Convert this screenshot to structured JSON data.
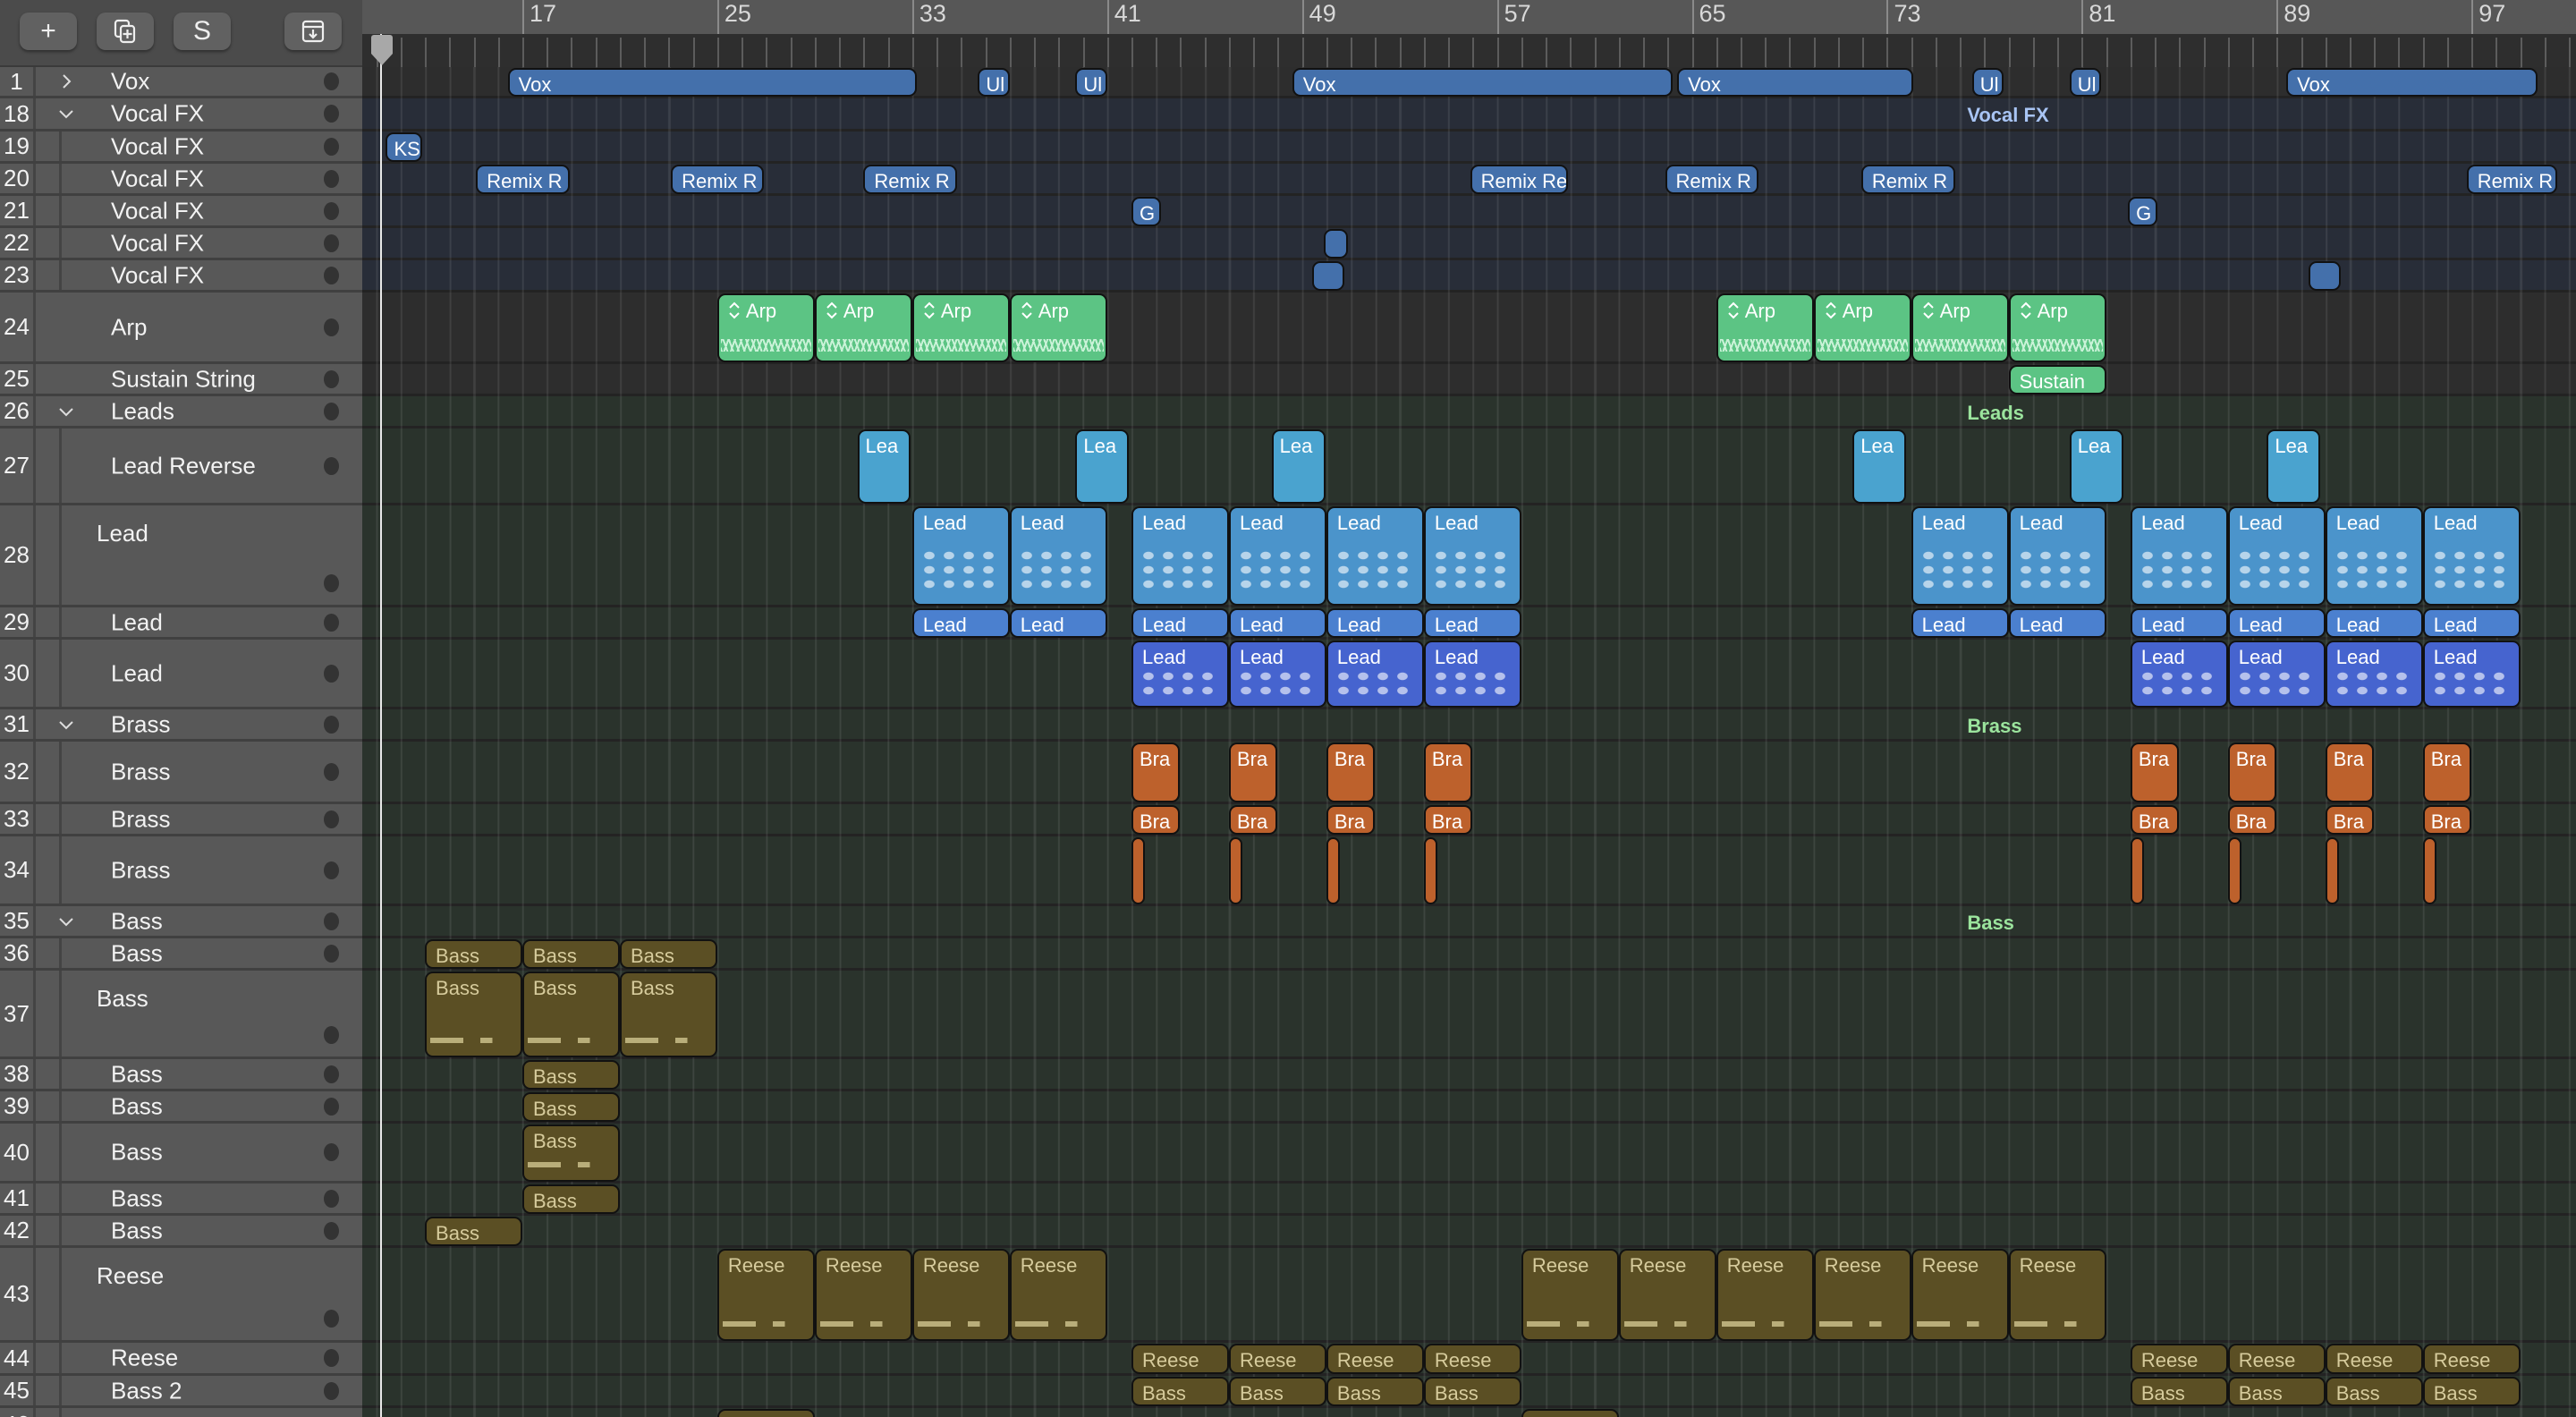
{
  "toolbar": {
    "add_label": "+",
    "solo_label": "S"
  },
  "ruler": {
    "labels": [
      "17",
      "25",
      "33",
      "41",
      "49",
      "57",
      "65",
      "73",
      "81",
      "89",
      "97"
    ],
    "label_bars": [
      17,
      25,
      33,
      41,
      49,
      57,
      65,
      73,
      81,
      89,
      97
    ],
    "first_bar": 11,
    "last_bar": 102
  },
  "colors": {
    "vox": "#4470ab",
    "arp": "#5cc484",
    "leadrev": "#4aa3cf",
    "lead": "#4b94cb",
    "lead2": "#4b80cf",
    "lead3": "#4664cf",
    "brass": "#bd612c",
    "bass": "#5b4f24",
    "basstext": "#d6cb9c",
    "vocalfx_label": "#a8c4f4",
    "folder_label": "#9be49d"
  },
  "tracks": [
    {
      "num": "1",
      "name": "Vox",
      "kind": "folder-collapsed"
    },
    {
      "num": "18",
      "name": "Vocal FX",
      "kind": "folder-open"
    },
    {
      "num": "19",
      "name": "Vocal FX",
      "kind": "sub"
    },
    {
      "num": "20",
      "name": "Vocal FX",
      "kind": "sub"
    },
    {
      "num": "21",
      "name": "Vocal FX",
      "kind": "sub"
    },
    {
      "num": "22",
      "name": "Vocal FX",
      "kind": "sub"
    },
    {
      "num": "23",
      "name": "Vocal FX",
      "kind": "sub"
    },
    {
      "num": "24",
      "name": "Arp",
      "kind": "track"
    },
    {
      "num": "25",
      "name": "Sustain String",
      "kind": "track"
    },
    {
      "num": "26",
      "name": "Leads",
      "kind": "folder-open"
    },
    {
      "num": "27",
      "name": "Lead Reverse",
      "kind": "sub"
    },
    {
      "num": "28",
      "name": "Lead",
      "kind": "sub"
    },
    {
      "num": "29",
      "name": "Lead",
      "kind": "sub"
    },
    {
      "num": "30",
      "name": "Lead",
      "kind": "sub"
    },
    {
      "num": "31",
      "name": "Brass",
      "kind": "folder-open"
    },
    {
      "num": "32",
      "name": "Brass",
      "kind": "sub"
    },
    {
      "num": "33",
      "name": "Brass",
      "kind": "sub"
    },
    {
      "num": "34",
      "name": "Brass",
      "kind": "sub"
    },
    {
      "num": "35",
      "name": "Bass",
      "kind": "folder-open"
    },
    {
      "num": "36",
      "name": "Bass",
      "kind": "sub"
    },
    {
      "num": "37",
      "name": "Bass",
      "kind": "sub"
    },
    {
      "num": "38",
      "name": "Bass",
      "kind": "sub"
    },
    {
      "num": "39",
      "name": "Bass",
      "kind": "sub"
    },
    {
      "num": "40",
      "name": "Bass",
      "kind": "sub"
    },
    {
      "num": "41",
      "name": "Bass",
      "kind": "sub"
    },
    {
      "num": "42",
      "name": "Bass",
      "kind": "sub"
    },
    {
      "num": "43",
      "name": "Reese",
      "kind": "sub"
    },
    {
      "num": "44",
      "name": "Reese",
      "kind": "sub"
    },
    {
      "num": "45",
      "name": "Bass 2",
      "kind": "sub"
    },
    {
      "num": "46",
      "name": "",
      "kind": "sub"
    }
  ],
  "folder_labels": [
    {
      "track": "18",
      "text": "Vocal FX",
      "bar": 76.3,
      "color": "vocalfx_label"
    },
    {
      "track": "26",
      "text": "Leads",
      "bar": 76.3,
      "color": "folder_label"
    },
    {
      "track": "31",
      "text": "Brass",
      "bar": 76.3,
      "color": "folder_label"
    },
    {
      "track": "35",
      "text": "Bass",
      "bar": 76.3,
      "color": "folder_label"
    }
  ],
  "regions": [
    {
      "track": "1",
      "label": "Vox",
      "start": 16.4,
      "len": 16.8,
      "color": "vox"
    },
    {
      "track": "1",
      "label": "Ul",
      "start": 35.7,
      "len": 1.3,
      "color": "vox"
    },
    {
      "track": "1",
      "label": "Ul",
      "start": 39.7,
      "len": 1.3,
      "color": "vox"
    },
    {
      "track": "1",
      "label": "Vox",
      "start": 48.6,
      "len": 15.6,
      "color": "vox"
    },
    {
      "track": "1",
      "label": "Vox",
      "start": 64.4,
      "len": 9.7,
      "color": "vox"
    },
    {
      "track": "1",
      "label": "Ul",
      "start": 76.5,
      "len": 1.3,
      "color": "vox"
    },
    {
      "track": "1",
      "label": "Ul",
      "start": 80.5,
      "len": 1.3,
      "color": "vox"
    },
    {
      "track": "1",
      "label": "Vox",
      "start": 89.4,
      "len": 10.3,
      "color": "vox"
    },
    {
      "track": "19",
      "label": "KS",
      "start": 11.4,
      "len": 1.5,
      "color": "vox"
    },
    {
      "track": "20",
      "label": "Remix R",
      "start": 15.1,
      "len": 3.85,
      "color": "vox"
    },
    {
      "track": "20",
      "label": "Remix R",
      "start": 23.1,
      "len": 3.8,
      "color": "vox"
    },
    {
      "track": "20",
      "label": "Remix R",
      "start": 31.0,
      "len": 3.85,
      "color": "vox"
    },
    {
      "track": "20",
      "label": "Remix Re",
      "start": 55.9,
      "len": 4.0,
      "color": "vox"
    },
    {
      "track": "20",
      "label": "Remix R",
      "start": 63.9,
      "len": 3.85,
      "color": "vox"
    },
    {
      "track": "20",
      "label": "Remix R",
      "start": 71.95,
      "len": 3.85,
      "color": "vox"
    },
    {
      "track": "20",
      "label": "Remix R",
      "start": 96.8,
      "len": 3.7,
      "color": "vox"
    },
    {
      "track": "21",
      "label": "G",
      "start": 42.0,
      "len": 1.2,
      "color": "vox"
    },
    {
      "track": "21",
      "label": "G",
      "start": 82.9,
      "len": 1.2,
      "color": "vox"
    },
    {
      "track": "22",
      "label": "",
      "start": 49.9,
      "len": 1.0,
      "color": "vox"
    },
    {
      "track": "23",
      "label": "",
      "start": 49.4,
      "len": 1.35,
      "color": "vox"
    },
    {
      "track": "23",
      "label": "",
      "start": 90.3,
      "len": 1.35,
      "color": "vox"
    },
    {
      "track": "24",
      "label": "Arp",
      "start": 25,
      "len": 4,
      "color": "arp",
      "loop": true
    },
    {
      "track": "24",
      "label": "Arp",
      "start": 29,
      "len": 4,
      "color": "arp",
      "loop": true
    },
    {
      "track": "24",
      "label": "Arp",
      "start": 33,
      "len": 4,
      "color": "arp",
      "loop": true
    },
    {
      "track": "24",
      "label": "Arp",
      "start": 37,
      "len": 4,
      "color": "arp",
      "loop": true
    },
    {
      "track": "24",
      "label": "Arp",
      "start": 66,
      "len": 4,
      "color": "arp",
      "loop": true
    },
    {
      "track": "24",
      "label": "Arp",
      "start": 70,
      "len": 4,
      "color": "arp",
      "loop": true
    },
    {
      "track": "24",
      "label": "Arp",
      "start": 74,
      "len": 4,
      "color": "arp",
      "loop": true
    },
    {
      "track": "24",
      "label": "Arp",
      "start": 78,
      "len": 4,
      "color": "arp",
      "loop": true
    },
    {
      "track": "25",
      "label": "Sustain",
      "start": 78,
      "len": 4,
      "color": "arp"
    },
    {
      "track": "27",
      "label": "Lea",
      "start": 30.75,
      "len": 2.2,
      "color": "leadrev"
    },
    {
      "track": "27",
      "label": "Lea",
      "start": 39.7,
      "len": 2.2,
      "color": "leadrev"
    },
    {
      "track": "27",
      "label": "Lea",
      "start": 47.75,
      "len": 2.2,
      "color": "leadrev"
    },
    {
      "track": "27",
      "label": "Lea",
      "start": 71.6,
      "len": 2.2,
      "color": "leadrev"
    },
    {
      "track": "27",
      "label": "Lea",
      "start": 80.5,
      "len": 2.2,
      "color": "leadrev"
    },
    {
      "track": "27",
      "label": "Lea",
      "start": 88.6,
      "len": 2.2,
      "color": "leadrev"
    },
    {
      "track": "28",
      "label": "Lead",
      "start": 33,
      "len": 4,
      "color": "lead"
    },
    {
      "track": "28",
      "label": "Lead",
      "start": 37,
      "len": 4,
      "color": "lead"
    },
    {
      "track": "28",
      "label": "Lead",
      "start": 42,
      "len": 4,
      "color": "lead"
    },
    {
      "track": "28",
      "label": "Lead",
      "start": 46,
      "len": 4,
      "color": "lead"
    },
    {
      "track": "28",
      "label": "Lead",
      "start": 50,
      "len": 4,
      "color": "lead"
    },
    {
      "track": "28",
      "label": "Lead",
      "start": 54,
      "len": 4,
      "color": "lead"
    },
    {
      "track": "28",
      "label": "Lead",
      "start": 74,
      "len": 4,
      "color": "lead"
    },
    {
      "track": "28",
      "label": "Lead",
      "start": 78,
      "len": 4,
      "color": "lead"
    },
    {
      "track": "28",
      "label": "Lead",
      "start": 83,
      "len": 4,
      "color": "lead"
    },
    {
      "track": "28",
      "label": "Lead",
      "start": 87,
      "len": 4,
      "color": "lead"
    },
    {
      "track": "28",
      "label": "Lead",
      "start": 91,
      "len": 4,
      "color": "lead"
    },
    {
      "track": "28",
      "label": "Lead",
      "start": 95,
      "len": 4,
      "color": "lead"
    },
    {
      "track": "29",
      "label": "Lead",
      "start": 33,
      "len": 4,
      "color": "lead2"
    },
    {
      "track": "29",
      "label": "Lead",
      "start": 37,
      "len": 4,
      "color": "lead2"
    },
    {
      "track": "29",
      "label": "Lead",
      "start": 42,
      "len": 4,
      "color": "lead2"
    },
    {
      "track": "29",
      "label": "Lead",
      "start": 46,
      "len": 4,
      "color": "lead2"
    },
    {
      "track": "29",
      "label": "Lead",
      "start": 50,
      "len": 4,
      "color": "lead2"
    },
    {
      "track": "29",
      "label": "Lead",
      "start": 54,
      "len": 4,
      "color": "lead2"
    },
    {
      "track": "29",
      "label": "Lead",
      "start": 74,
      "len": 4,
      "color": "lead2"
    },
    {
      "track": "29",
      "label": "Lead",
      "start": 78,
      "len": 4,
      "color": "lead2"
    },
    {
      "track": "29",
      "label": "Lead",
      "start": 83,
      "len": 4,
      "color": "lead2"
    },
    {
      "track": "29",
      "label": "Lead",
      "start": 87,
      "len": 4,
      "color": "lead2"
    },
    {
      "track": "29",
      "label": "Lead",
      "start": 91,
      "len": 4,
      "color": "lead2"
    },
    {
      "track": "29",
      "label": "Lead",
      "start": 95,
      "len": 4,
      "color": "lead2"
    },
    {
      "track": "30",
      "label": "Lead",
      "start": 42,
      "len": 4,
      "color": "lead3"
    },
    {
      "track": "30",
      "label": "Lead",
      "start": 46,
      "len": 4,
      "color": "lead3"
    },
    {
      "track": "30",
      "label": "Lead",
      "start": 50,
      "len": 4,
      "color": "lead3"
    },
    {
      "track": "30",
      "label": "Lead",
      "start": 54,
      "len": 4,
      "color": "lead3"
    },
    {
      "track": "30",
      "label": "Lead",
      "start": 83,
      "len": 4,
      "color": "lead3"
    },
    {
      "track": "30",
      "label": "Lead",
      "start": 87,
      "len": 4,
      "color": "lead3"
    },
    {
      "track": "30",
      "label": "Lead",
      "start": 91,
      "len": 4,
      "color": "lead3"
    },
    {
      "track": "30",
      "label": "Lead",
      "start": 95,
      "len": 4,
      "color": "lead3"
    },
    {
      "track": "32",
      "label": "Bra",
      "start": 42,
      "len": 2,
      "color": "brass"
    },
    {
      "track": "32",
      "label": "Bra",
      "start": 46,
      "len": 2,
      "color": "brass"
    },
    {
      "track": "32",
      "label": "Bra",
      "start": 50,
      "len": 2,
      "color": "brass"
    },
    {
      "track": "32",
      "label": "Bra",
      "start": 54,
      "len": 2,
      "color": "brass"
    },
    {
      "track": "32",
      "label": "Bra",
      "start": 83,
      "len": 2,
      "color": "brass"
    },
    {
      "track": "32",
      "label": "Bra",
      "start": 87,
      "len": 2,
      "color": "brass"
    },
    {
      "track": "32",
      "label": "Bra",
      "start": 91,
      "len": 2,
      "color": "brass"
    },
    {
      "track": "32",
      "label": "Bra",
      "start": 95,
      "len": 2,
      "color": "brass"
    },
    {
      "track": "33",
      "label": "Bra",
      "start": 42,
      "len": 2,
      "color": "brass"
    },
    {
      "track": "33",
      "label": "Bra",
      "start": 46,
      "len": 2,
      "color": "brass"
    },
    {
      "track": "33",
      "label": "Bra",
      "start": 50,
      "len": 2,
      "color": "brass"
    },
    {
      "track": "33",
      "label": "Bra",
      "start": 54,
      "len": 2,
      "color": "brass"
    },
    {
      "track": "33",
      "label": "Bra",
      "start": 83,
      "len": 2,
      "color": "brass"
    },
    {
      "track": "33",
      "label": "Bra",
      "start": 87,
      "len": 2,
      "color": "brass"
    },
    {
      "track": "33",
      "label": "Bra",
      "start": 91,
      "len": 2,
      "color": "brass"
    },
    {
      "track": "33",
      "label": "Bra",
      "start": 95,
      "len": 2,
      "color": "brass"
    },
    {
      "track": "34",
      "label": "",
      "start": 42,
      "len": 0.55,
      "color": "brass"
    },
    {
      "track": "34",
      "label": "",
      "start": 46,
      "len": 0.55,
      "color": "brass"
    },
    {
      "track": "34",
      "label": "",
      "start": 50,
      "len": 0.55,
      "color": "brass"
    },
    {
      "track": "34",
      "label": "",
      "start": 54,
      "len": 0.55,
      "color": "brass"
    },
    {
      "track": "34",
      "label": "",
      "start": 83,
      "len": 0.55,
      "color": "brass"
    },
    {
      "track": "34",
      "label": "",
      "start": 87,
      "len": 0.55,
      "color": "brass"
    },
    {
      "track": "34",
      "label": "",
      "start": 91,
      "len": 0.55,
      "color": "brass"
    },
    {
      "track": "34",
      "label": "",
      "start": 95,
      "len": 0.55,
      "color": "brass"
    },
    {
      "track": "36",
      "label": "Bass",
      "start": 13,
      "len": 4,
      "color": "bass"
    },
    {
      "track": "36",
      "label": "Bass",
      "start": 17,
      "len": 4,
      "color": "bass"
    },
    {
      "track": "36",
      "label": "Bass",
      "start": 21,
      "len": 4,
      "color": "bass"
    },
    {
      "track": "37",
      "label": "Bass",
      "start": 13,
      "len": 4,
      "color": "bass"
    },
    {
      "track": "37",
      "label": "Bass",
      "start": 17,
      "len": 4,
      "color": "bass"
    },
    {
      "track": "37",
      "label": "Bass",
      "start": 21,
      "len": 4,
      "color": "bass"
    },
    {
      "track": "38",
      "label": "Bass",
      "start": 17,
      "len": 4,
      "color": "bass"
    },
    {
      "track": "39",
      "label": "Bass",
      "start": 17,
      "len": 4,
      "color": "bass"
    },
    {
      "track": "40",
      "label": "Bass",
      "start": 17,
      "len": 4,
      "color": "bass"
    },
    {
      "track": "41",
      "label": "Bass",
      "start": 17,
      "len": 4,
      "color": "bass"
    },
    {
      "track": "42",
      "label": "Bass",
      "start": 13,
      "len": 4,
      "color": "bass"
    },
    {
      "track": "43",
      "label": "Reese",
      "start": 25,
      "len": 4,
      "color": "bass"
    },
    {
      "track": "43",
      "label": "Reese",
      "start": 29,
      "len": 4,
      "color": "bass"
    },
    {
      "track": "43",
      "label": "Reese",
      "start": 33,
      "len": 4,
      "color": "bass"
    },
    {
      "track": "43",
      "label": "Reese",
      "start": 37,
      "len": 4,
      "color": "bass"
    },
    {
      "track": "43",
      "label": "Reese",
      "start": 58,
      "len": 4,
      "color": "bass"
    },
    {
      "track": "43",
      "label": "Reese",
      "start": 62,
      "len": 4,
      "color": "bass"
    },
    {
      "track": "43",
      "label": "Reese",
      "start": 66,
      "len": 4,
      "color": "bass"
    },
    {
      "track": "43",
      "label": "Reese",
      "start": 70,
      "len": 4,
      "color": "bass"
    },
    {
      "track": "43",
      "label": "Reese",
      "start": 74,
      "len": 4,
      "color": "bass"
    },
    {
      "track": "43",
      "label": "Reese",
      "start": 78,
      "len": 4,
      "color": "bass"
    },
    {
      "track": "44",
      "label": "Reese",
      "start": 42,
      "len": 4,
      "color": "bass"
    },
    {
      "track": "44",
      "label": "Reese",
      "start": 46,
      "len": 4,
      "color": "bass"
    },
    {
      "track": "44",
      "label": "Reese",
      "start": 50,
      "len": 4,
      "color": "bass"
    },
    {
      "track": "44",
      "label": "Reese",
      "start": 54,
      "len": 4,
      "color": "bass"
    },
    {
      "track": "44",
      "label": "Reese",
      "start": 83,
      "len": 4,
      "color": "bass"
    },
    {
      "track": "44",
      "label": "Reese",
      "start": 87,
      "len": 4,
      "color": "bass"
    },
    {
      "track": "44",
      "label": "Reese",
      "start": 91,
      "len": 4,
      "color": "bass"
    },
    {
      "track": "44",
      "label": "Reese",
      "start": 95,
      "len": 4,
      "color": "bass"
    },
    {
      "track": "45",
      "label": "Bass",
      "start": 42,
      "len": 4,
      "color": "bass"
    },
    {
      "track": "45",
      "label": "Bass",
      "start": 46,
      "len": 4,
      "color": "bass"
    },
    {
      "track": "45",
      "label": "Bass",
      "start": 50,
      "len": 4,
      "color": "bass"
    },
    {
      "track": "45",
      "label": "Bass",
      "start": 54,
      "len": 4,
      "color": "bass"
    },
    {
      "track": "45",
      "label": "Bass",
      "start": 83,
      "len": 4,
      "color": "bass"
    },
    {
      "track": "45",
      "label": "Bass",
      "start": 87,
      "len": 4,
      "color": "bass"
    },
    {
      "track": "45",
      "label": "Bass",
      "start": 91,
      "len": 4,
      "color": "bass"
    },
    {
      "track": "45",
      "label": "Bass",
      "start": 95,
      "len": 4,
      "color": "bass"
    },
    {
      "track": "46",
      "label": "",
      "start": 25,
      "len": 4,
      "color": "bass"
    },
    {
      "track": "46",
      "label": "",
      "start": 58,
      "len": 4,
      "color": "bass"
    }
  ]
}
